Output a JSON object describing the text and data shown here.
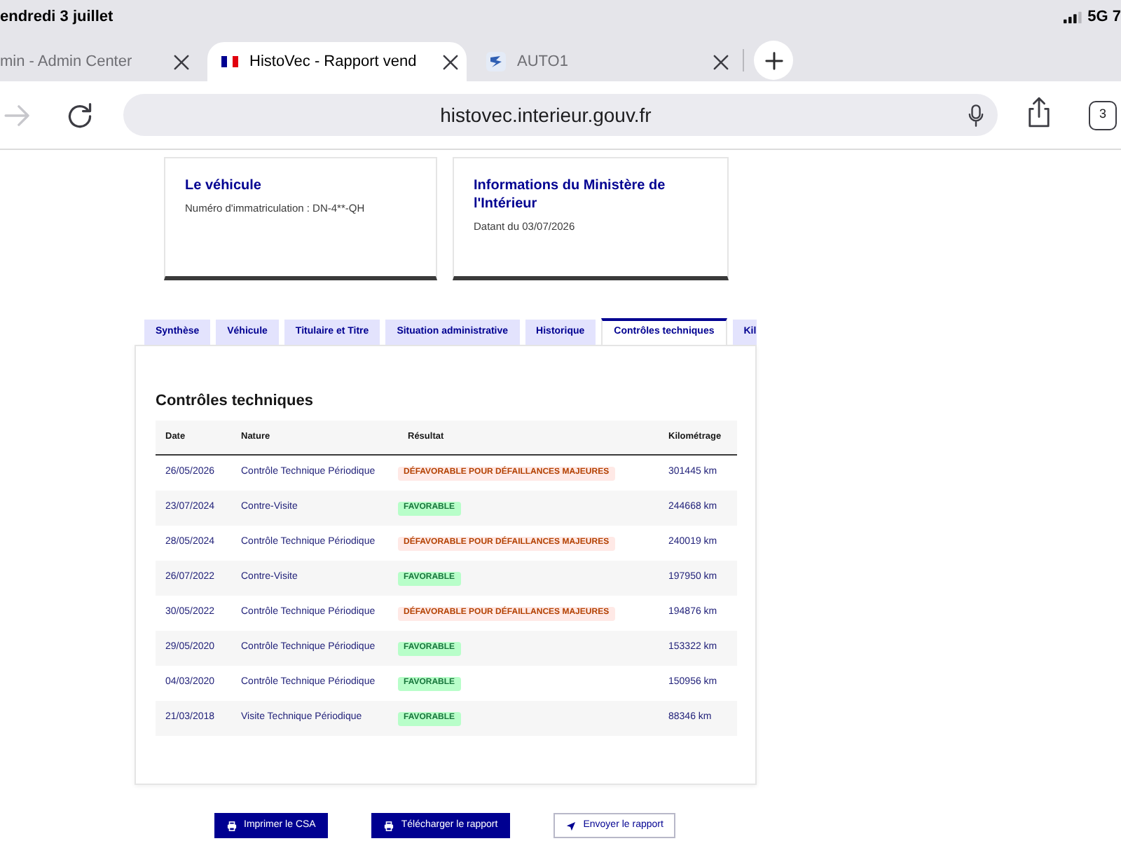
{
  "status_bar": {
    "date": "endredi 3 juillet",
    "network": "5G 7"
  },
  "browser_tabs": [
    {
      "title": "min - Admin Center",
      "selected": false,
      "kind": "plain"
    },
    {
      "title": "HistoVec - Rapport vend",
      "selected": true,
      "kind": "flag"
    },
    {
      "title": "AUTO1",
      "selected": false,
      "kind": "logo"
    }
  ],
  "toolbar": {
    "forward_disabled": true,
    "url": "histovec.interieur.gouv.fr",
    "tab_count": "3"
  },
  "cards": [
    {
      "title": "Le véhicule",
      "text": "Numéro d'immatriculation : DN-4**-QH"
    },
    {
      "title": "Informations du Ministère de l'Intérieur",
      "text": "Datant du 03/07/2026"
    }
  ],
  "tabs": [
    {
      "label": "Synthèse",
      "selected": false
    },
    {
      "label": "Véhicule",
      "selected": false
    },
    {
      "label": "Titulaire et Titre",
      "selected": false
    },
    {
      "label": "Situation administrative",
      "selected": false
    },
    {
      "label": "Historique",
      "selected": false
    },
    {
      "label": "Contrôles techniques",
      "selected": true
    },
    {
      "label": "Kil",
      "selected": false
    }
  ],
  "panel": {
    "heading": "Contrôles techniques",
    "columns": [
      "Date",
      "Nature",
      "Résultat",
      "Kilométrage"
    ],
    "rows": [
      {
        "kind": "unfavorable",
        "date": "26/05/2026",
        "nature": "Contrôle Technique Périodique",
        "result": "DÉFAVORABLE POUR DÉFAILLANCES MAJEURES",
        "mileage": "301445 km"
      },
      {
        "kind": "favorable",
        "date": "23/07/2024",
        "nature": "Contre-Visite",
        "result": "FAVORABLE",
        "mileage": "244668 km"
      },
      {
        "kind": "unfavorable",
        "date": "28/05/2024",
        "nature": "Contrôle Technique Périodique",
        "result": "DÉFAVORABLE POUR DÉFAILLANCES MAJEURES",
        "mileage": "240019 km"
      },
      {
        "kind": "favorable",
        "date": "26/07/2022",
        "nature": "Contre-Visite",
        "result": "FAVORABLE",
        "mileage": "197950 km"
      },
      {
        "kind": "unfavorable",
        "date": "30/05/2022",
        "nature": "Contrôle Technique Périodique",
        "result": "DÉFAVORABLE POUR DÉFAILLANCES MAJEURES",
        "mileage": "194876 km"
      },
      {
        "kind": "favorable",
        "date": "29/05/2020",
        "nature": "Contrôle Technique Périodique",
        "result": "FAVORABLE",
        "mileage": "153322 km"
      },
      {
        "kind": "favorable",
        "date": "04/03/2020",
        "nature": "Contrôle Technique Périodique",
        "result": "FAVORABLE",
        "mileage": "150956 km"
      },
      {
        "kind": "favorable",
        "date": "21/03/2018",
        "nature": "Visite Technique Périodique",
        "result": "FAVORABLE",
        "mileage": "88346 km"
      }
    ]
  },
  "buttons": [
    {
      "label": "Imprimer le CSA",
      "kind": "primary"
    },
    {
      "label": "Télécharger le rapport",
      "kind": "primary"
    },
    {
      "label": "Envoyer le rapport",
      "kind": "secondary"
    }
  ]
}
